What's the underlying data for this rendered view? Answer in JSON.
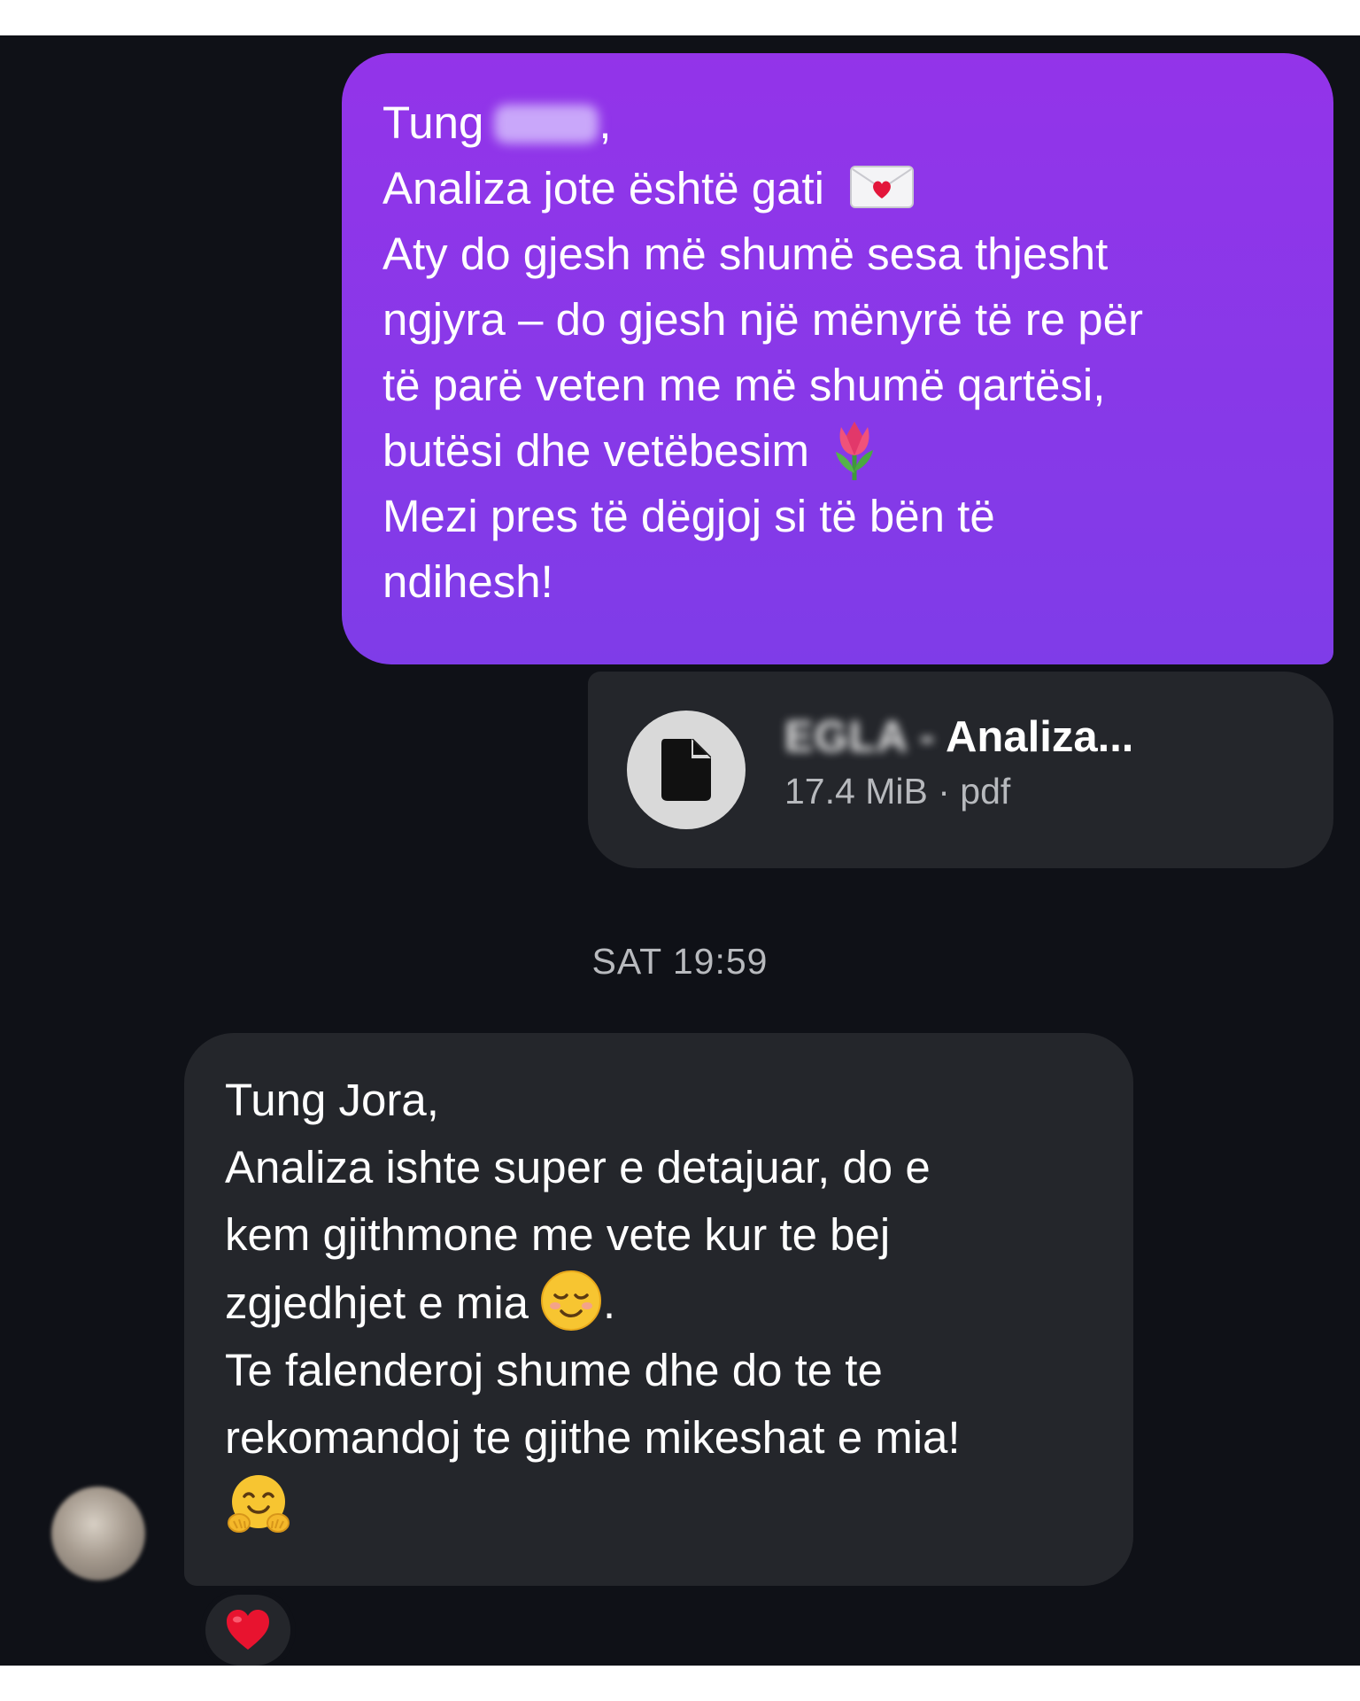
{
  "outgoing_message": {
    "lines": [
      "Tung",
      "Analiza jote është gati",
      "Aty do gjesh më shumë sesa thjesht",
      "ngjyra – do gjesh një mënyrë të re për",
      "të parë veten me më shumë qartësi,",
      "butësi dhe vetëbesim",
      "Mezi pres të dëgjoj si të bën të",
      "ndihesh!"
    ],
    "emoji": [
      "love-letter-icon",
      "tulip-icon"
    ]
  },
  "attachment": {
    "name_prefix": "EGLA -",
    "name": "Analiza...",
    "size": "17.4 MiB",
    "separator": "·",
    "type": "pdf",
    "icon": "document-icon"
  },
  "timestamp": "SAT 19:59",
  "incoming_message": {
    "lines": [
      "Tung Jora,",
      "Analiza ishte super e detajuar, do e",
      "kem gjithmone me vete kur te bej",
      "zgjedhjet e mia",
      ".",
      "Te falenderoj shume dhe do te te",
      "rekomandoj te gjithe mikeshat e mia!"
    ],
    "emoji": [
      "smiling-face-icon",
      "hugging-face-icon"
    ]
  },
  "reaction": "heart-icon",
  "colors": {
    "outgoing_bubble": "#8b38e9",
    "incoming_bubble": "#24262b",
    "background": "#0f1117",
    "heart": "#e8132f"
  }
}
